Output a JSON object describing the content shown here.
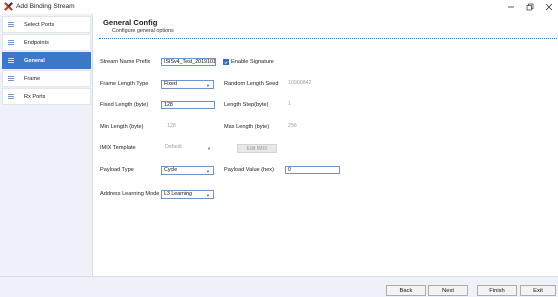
{
  "window": {
    "title": "Add Binding Stream"
  },
  "sidebar": {
    "items": [
      {
        "label": "Select Ports",
        "active": false
      },
      {
        "label": "Endpoints",
        "active": false
      },
      {
        "label": "General",
        "active": true
      },
      {
        "label": "Frame",
        "active": false
      },
      {
        "label": "Rx Ports",
        "active": false
      }
    ]
  },
  "section": {
    "title": "General Config",
    "subtitle": "Configure general options"
  },
  "form": {
    "stream_name_prefix": {
      "label": "Stream Name Prefix",
      "value": "ISISv4_Test_2019101"
    },
    "enable_signature": {
      "label": "Enable Signature",
      "checked": true
    },
    "frame_length_type": {
      "label": "Frame Length Type",
      "value": "Fixed"
    },
    "random_length_seed": {
      "label": "Random Length Seed",
      "value": "10900842"
    },
    "fixed_length": {
      "label": "Fixed Length (byte)",
      "value": "128"
    },
    "length_step": {
      "label": "Length Step(byte)",
      "value": "1"
    },
    "min_length": {
      "label": "Min Length (byte)",
      "value": "128"
    },
    "max_length": {
      "label": "Max Length (byte)",
      "value": "256"
    },
    "imix_template": {
      "label": "IMIX Template",
      "value": "Default"
    },
    "edit_imix": {
      "label": "Edit IMIX"
    },
    "payload_type": {
      "label": "Payload Type",
      "value": "Cycle"
    },
    "payload_value": {
      "label": "Payload Value (hex)",
      "value": "0"
    },
    "address_learning_mode": {
      "label": "Address Learning Mode",
      "value": "L3 Learning"
    }
  },
  "footer": {
    "back": "Back",
    "next": "Next",
    "finish": "Finish",
    "exit": "Exit"
  },
  "colors": {
    "accent": "#3c78c8",
    "sidebar_bg": "#eef2f8",
    "input_border": "#6b95c9"
  }
}
